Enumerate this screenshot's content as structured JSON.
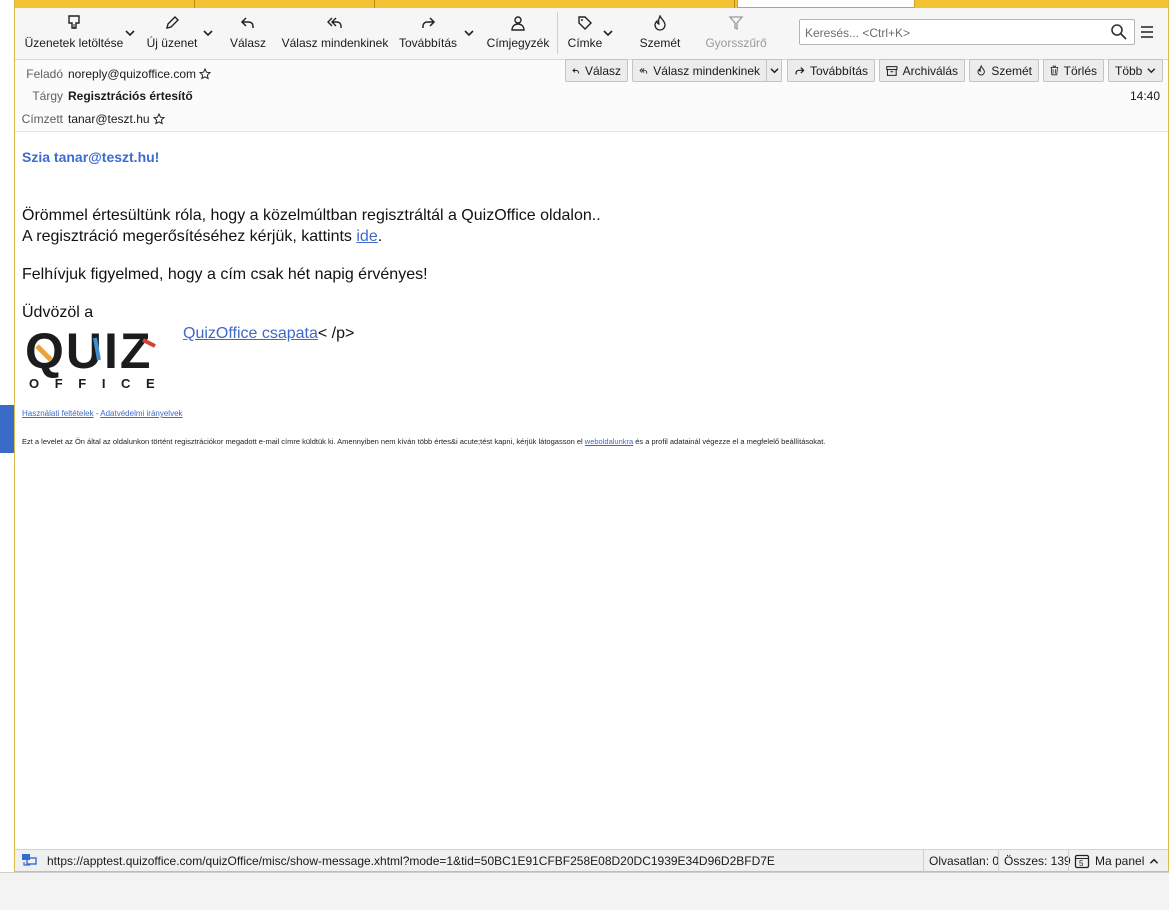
{
  "toolbar": {
    "get_messages": "Üzenetek letöltése",
    "new_message": "Új üzenet",
    "reply": "Válasz",
    "reply_all": "Válasz mindenkinek",
    "forward": "Továbbítás",
    "address_book": "Címjegyzék",
    "tag": "Címke",
    "junk": "Szemét",
    "quick_filter": "Gyorsszűrő",
    "search_placeholder": "Keresés... <Ctrl+K>"
  },
  "header": {
    "from_label": "Feladó",
    "from_value": "noreply@quizoffice.com",
    "subject_label": "Tárgy",
    "subject_value": "Regisztrációs értesítő",
    "to_label": "Címzett",
    "to_value": "tanar@teszt.hu",
    "time": "14:40",
    "buttons": {
      "reply": "Válasz",
      "reply_all": "Válasz mindenkinek",
      "forward": "Továbbítás",
      "archive": "Archiválás",
      "junk": "Szemét",
      "delete": "Törlés",
      "more": "Több"
    }
  },
  "message": {
    "greeting": "Szia tanar@teszt.hu!",
    "line1": "Örömmel értesültünk róla, hogy a közelmúltban regisztráltál a QuizOffice oldalon..",
    "line2_prefix": "A regisztráció megerősítéséhez kérjük, kattints ",
    "line2_link": "ide",
    "line2_suffix": ".",
    "line3": "Felhívjuk figyelmed, hogy a cím csak hét napig érvényes!",
    "sign_prefix": "Üdvözöl a",
    "sign_link": "QuizOffice csapata",
    "sign_suffix": "< /p>",
    "logo_word": "QUIZ",
    "logo_sub": "O F F I C E",
    "terms_link": "Használati feltételek",
    "link_sep": " - ",
    "privacy_link": "Adatvédelmi irányelvek",
    "disclaimer_prefix": "Ezt a levelet az Ön által az oldalunkon történt regisztrációkor megadott e-mail címre küldtük ki. Amennyiben nem kíván több értes&i acute;tést kapni, kérjük látogasson el ",
    "disclaimer_link": "weboldalunkra",
    "disclaimer_suffix": " és a profil adatainál végezze el a megfelelő beállításokat."
  },
  "status": {
    "url": "https://apptest.quizoffice.com/quizOffice/misc/show-message.xhtml?mode=1&tid=50BC1E91CFBF258E08D20DC1939E34D96D2BFD7E",
    "unread": "Olvasatlan: 0",
    "total": "Összes: 139",
    "today_pane": "Ma panel",
    "today_day": "5"
  },
  "colors": {
    "accent": "#f2c233",
    "link": "#3e69c9",
    "greeting": "#3b6bd0"
  }
}
